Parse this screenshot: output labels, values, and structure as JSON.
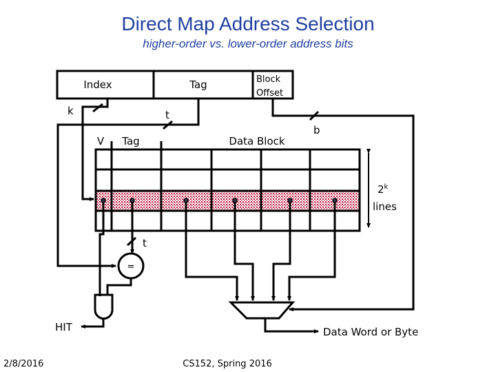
{
  "title": "Direct Map Address Selection",
  "subtitle": "higher-order vs. lower-order address bits",
  "address": {
    "index": "Index",
    "tag": "Tag",
    "block_offset_1": "Block",
    "block_offset_2": "Offset"
  },
  "wires": {
    "k": "k",
    "t_top": "t",
    "b": "b",
    "t_bottom": "t"
  },
  "cache": {
    "v": "V",
    "tag": "Tag",
    "data_block": "Data Block",
    "lines_base": "2",
    "lines_exp": "k",
    "lines_word": "lines",
    "highlight_color": "#c0143c"
  },
  "compare": "=",
  "hit": "HIT",
  "output": "Data Word or Byte",
  "footer": {
    "date": "2/8/2016",
    "course": "CS152, Spring 2016"
  }
}
